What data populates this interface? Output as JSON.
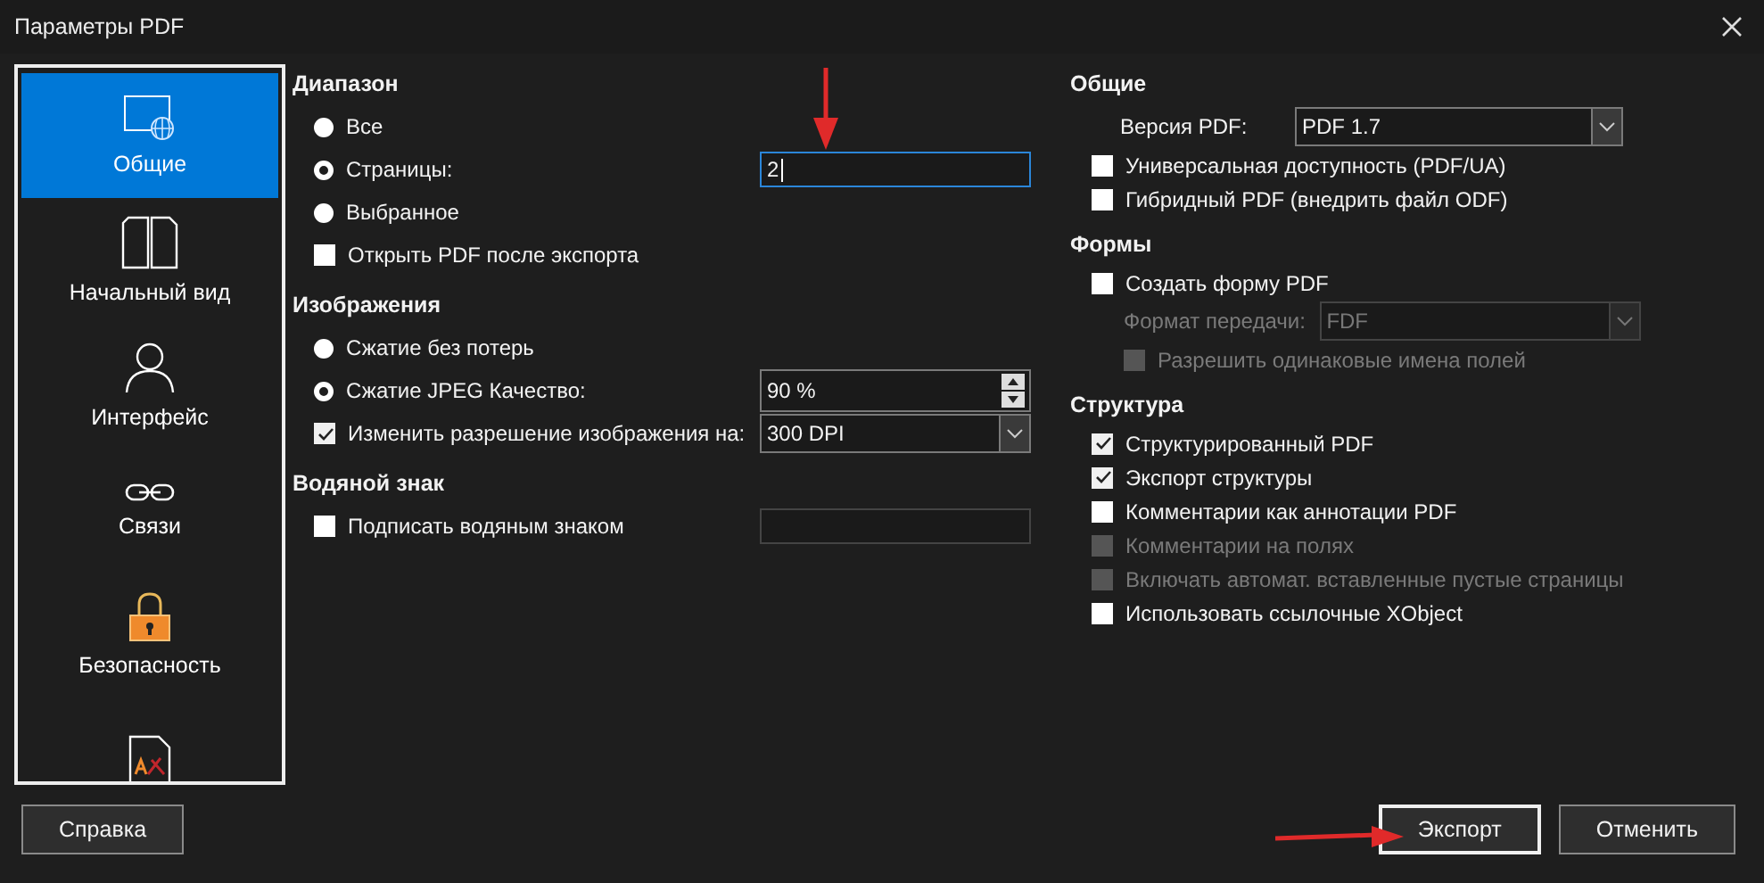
{
  "window": {
    "title": "Параметры PDF"
  },
  "sidebar": {
    "items": [
      {
        "label": "Общие",
        "kind": "general",
        "selected": true
      },
      {
        "label": "Начальный вид",
        "kind": "view",
        "selected": false
      },
      {
        "label": "Интерфейс",
        "kind": "user",
        "selected": false
      },
      {
        "label": "Связи",
        "kind": "links",
        "selected": false
      },
      {
        "label": "Безопасность",
        "kind": "security",
        "selected": false
      },
      {
        "kind": "signature",
        "selected": false
      }
    ]
  },
  "left_sections": [
    {
      "title": "Диапазон",
      "rows": [
        {
          "kind": "radio",
          "label": "Все",
          "selected": false
        },
        {
          "kind": "radio",
          "label": "Страницы:",
          "selected": true,
          "field": {
            "kind": "text",
            "value": "2",
            "focused": true,
            "marked": true
          }
        },
        {
          "kind": "radio",
          "label": "Выбранное",
          "selected": false
        },
        {
          "kind": "checkbox",
          "label": "Открыть PDF после экспорта",
          "checked": false
        }
      ]
    },
    {
      "title": "Изображения",
      "rows": [
        {
          "kind": "radio",
          "label": "Сжатие без потерь",
          "selected": false
        },
        {
          "kind": "radio",
          "label": "Сжатие JPEG  Качество:",
          "selected": true,
          "field": {
            "kind": "spin",
            "value": "90 %"
          }
        },
        {
          "kind": "checkbox",
          "label": "Изменить разрешение изображения на:",
          "checked": true,
          "field": {
            "kind": "combo",
            "value": "300 DPI"
          }
        }
      ]
    },
    {
      "title": "Водяной знак",
      "rows": [
        {
          "kind": "checkbox",
          "label": "Подписать водяным знаком",
          "checked": false,
          "field": {
            "kind": "text",
            "disabled": true
          }
        }
      ]
    }
  ],
  "right_sections": [
    {
      "title": "Общие",
      "rows": [
        {
          "kind": "label",
          "label": "Версия PDF:",
          "field": {
            "kind": "combo",
            "value": "PDF 1.7"
          }
        },
        {
          "kind": "checkbox",
          "label": "Универсальная доступность (PDF/UA)",
          "checked": false
        },
        {
          "kind": "checkbox",
          "label": "Гибридный PDF (внедрить файл ODF)",
          "checked": false
        }
      ]
    },
    {
      "title": "Формы",
      "rows": [
        {
          "kind": "checkbox",
          "label": "Создать форму PDF",
          "checked": false,
          "children": [
            {
              "kind": "label",
              "label": "Формат передачи:",
              "disabled": true,
              "field": {
                "kind": "combo",
                "value": "FDF",
                "disabled": true
              }
            },
            {
              "kind": "checkbox",
              "label": "Разрешить одинаковые имена полей",
              "checked": false,
              "disabled": true
            }
          ]
        }
      ]
    },
    {
      "title": "Структура",
      "rows": [
        {
          "kind": "checkbox",
          "label": "Структурированный PDF",
          "checked": true
        },
        {
          "kind": "checkbox",
          "label": "Экспорт структуры",
          "checked": true
        },
        {
          "kind": "checkbox",
          "label": "Комментарии как аннотации PDF",
          "checked": false
        },
        {
          "kind": "checkbox",
          "label": "Комментарии на полях",
          "checked": false,
          "disabled": true
        },
        {
          "kind": "checkbox",
          "label": "Включать автомат. вставленные пустые страницы",
          "checked": false,
          "disabled": true
        },
        {
          "kind": "checkbox",
          "label": "Использовать ссылочные XObject",
          "checked": false
        }
      ]
    }
  ],
  "buttons": [
    {
      "label": "Справка",
      "kind": "left",
      "default": false,
      "marked": false
    },
    {
      "label": "Экспорт",
      "kind": "right",
      "default": true,
      "marked": true
    },
    {
      "label": "Отменить",
      "kind": "right",
      "default": false,
      "marked": false
    }
  ]
}
